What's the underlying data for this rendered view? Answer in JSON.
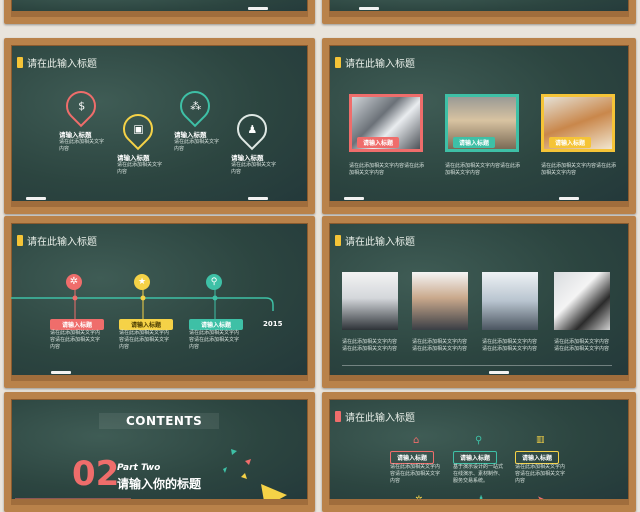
{
  "slides": {
    "s2": {
      "title": "请在此输入标题",
      "items": [
        {
          "label": "请输入标题",
          "desc": "请在此添加相关文字内容",
          "color": "#ef6d6b",
          "icon": "dollar-person-icon"
        },
        {
          "label": "请输入标题",
          "desc": "请在此添加相关文字内容",
          "color": "#f5d247",
          "icon": "presenter-icon"
        },
        {
          "label": "请输入标题",
          "desc": "请在此添加相关文字内容",
          "color": "#3ec0a6",
          "icon": "team-icon"
        },
        {
          "label": "请输入标题",
          "desc": "请在此添加相关文字内容",
          "color": "#dfe8e4",
          "icon": "user-icon"
        }
      ]
    },
    "s3": {
      "title": "请在此输入标题",
      "items": [
        {
          "label": "请输入标题",
          "desc": "请在此添加相关文字内容请在此添加相关文字内容",
          "color": "#ef6d6b"
        },
        {
          "label": "请输入标题",
          "desc": "请在此添加相关文字内容请在此添加相关文字内容",
          "color": "#3ec0a6"
        },
        {
          "label": "请输入标题",
          "desc": "请在此添加相关文字内容请在此添加相关文字内容",
          "color": "#f5c437"
        }
      ]
    },
    "s4": {
      "title": "请在此输入标题",
      "year": "2015",
      "items": [
        {
          "label": "请输入标题",
          "desc": "请在此添加相关文字内容请在此添加相关文字内容",
          "color": "#ef6d6b",
          "icon": "gear-icon"
        },
        {
          "label": "请输入标题",
          "desc": "请在此添加相关文字内容请在此添加相关文字内容",
          "color": "#f5d247",
          "icon": "star-icon"
        },
        {
          "label": "请输入标题",
          "desc": "请在此添加相关文字内容请在此添加相关文字内容",
          "color": "#3ec0a6",
          "icon": "search-icon"
        }
      ]
    },
    "s5": {
      "title": "请在此输入标题",
      "items": [
        {
          "desc": "请在此添加相关文字内容请在此添加相关文字内容"
        },
        {
          "desc": "请在此添加相关文字内容请在此添加相关文字内容"
        },
        {
          "desc": "请在此添加相关文字内容请在此添加相关文字内容"
        },
        {
          "desc": "请在此添加相关文字内容请在此添加相关文字内容"
        }
      ]
    },
    "s6": {
      "heading": "CONTENTS",
      "number": "02",
      "part": "Part Two",
      "subtitle": "请输入你的标题"
    },
    "s7": {
      "title": "请在此输入标题",
      "items": [
        {
          "label": "请输入标题",
          "desc": "请在此添加相关文字内容请在此添加相关文字内容",
          "color": "#ef6d6b"
        },
        {
          "label": "请输入标题",
          "desc": "基于演示设计的一站式在线演示、素材制作、服务交易系统。",
          "color": "#3ec0a6"
        },
        {
          "label": "请输入标题",
          "desc": "请在此添加相关文字内容请在此添加相关文字内容",
          "color": "#f5d247"
        }
      ]
    }
  }
}
